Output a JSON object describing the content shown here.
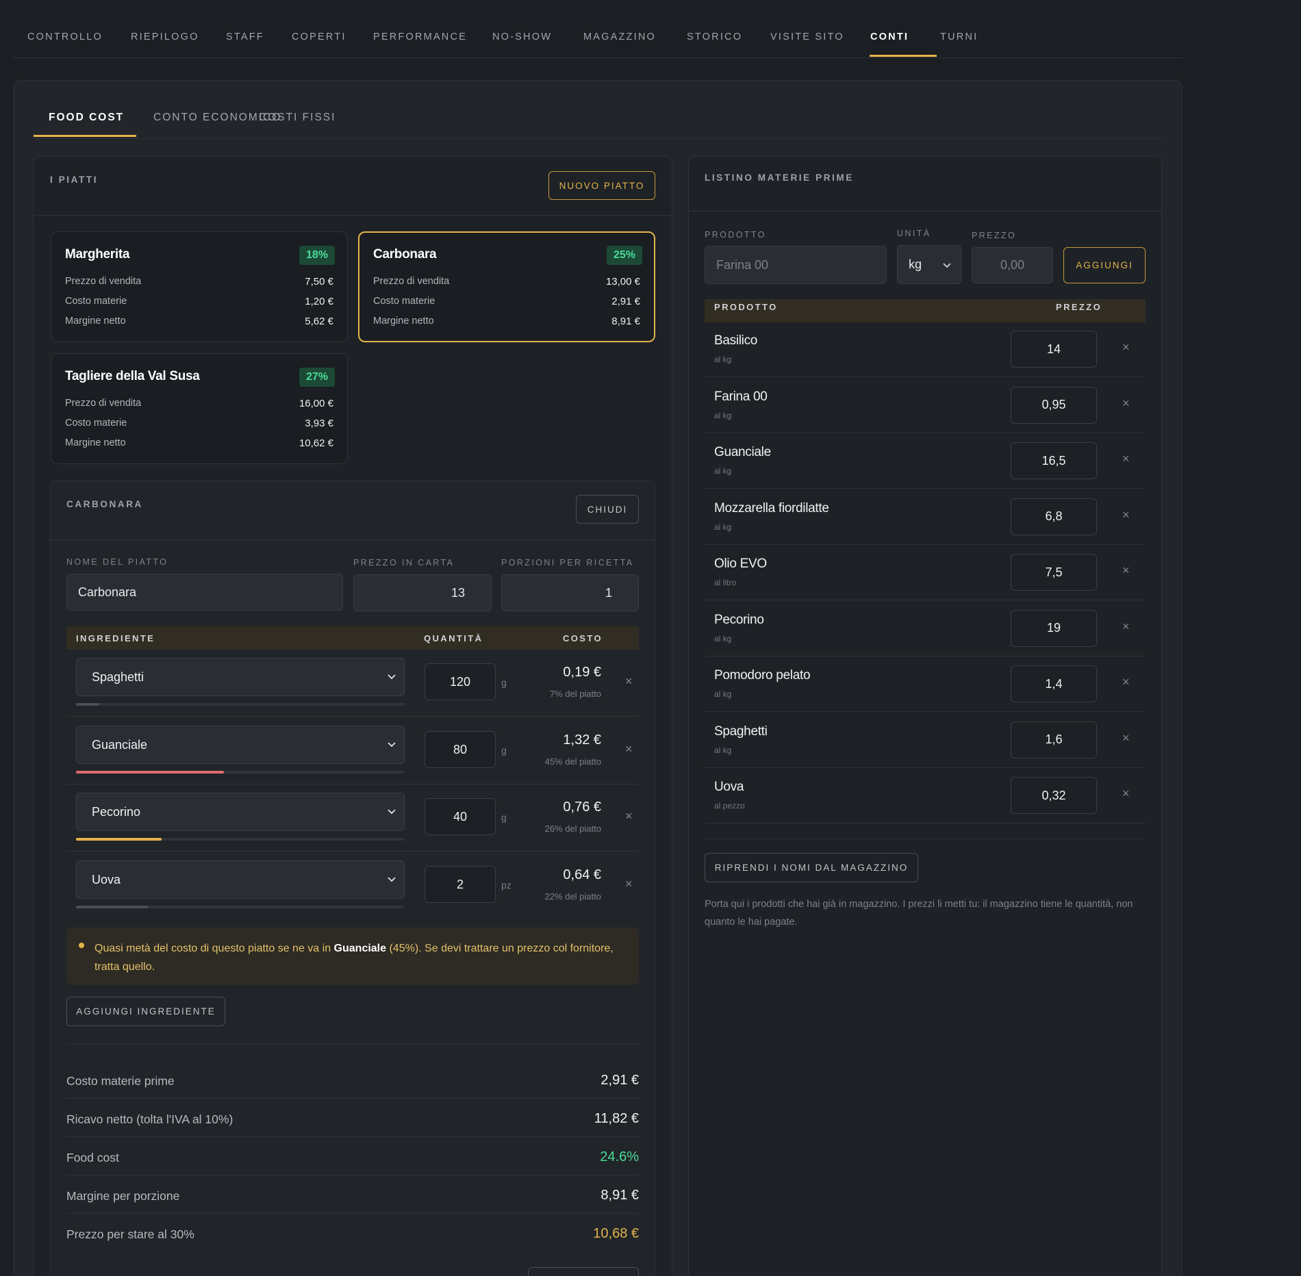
{
  "topnav": [
    "CONTROLLO",
    "RIEPILOGO",
    "STAFF",
    "COPERTI",
    "PERFORMANCE",
    "NO-SHOW",
    "MAGAZZINO",
    "STORICO",
    "VISITE SITO",
    "CONTI",
    "TURNI"
  ],
  "topnav_active": "CONTI",
  "subnav": [
    "FOOD COST",
    "CONTO ECONOMICO",
    "COSTI FISSI"
  ],
  "piatti": {
    "title": "I PIATTI",
    "new_button": "NUOVO PIATTO",
    "dishes": [
      {
        "name": "Margherita",
        "badge": "18%",
        "rows": [
          {
            "label": "Prezzo di vendita",
            "value": "7,50 €"
          },
          {
            "label": "Costo materie",
            "value": "1,20 €"
          },
          {
            "label": "Margine netto",
            "value": "5,62 €"
          }
        ]
      },
      {
        "name": "Carbonara",
        "badge": "25%",
        "rows": [
          {
            "label": "Prezzo di vendita",
            "value": "13,00 €"
          },
          {
            "label": "Costo materie",
            "value": "2,91 €"
          },
          {
            "label": "Margine netto",
            "value": "8,91 €"
          }
        ]
      },
      {
        "name": "Tagliere della Val Susa",
        "badge": "27%",
        "rows": [
          {
            "label": "Prezzo di vendita",
            "value": "16,00 €"
          },
          {
            "label": "Costo materie",
            "value": "3,93 €"
          },
          {
            "label": "Margine netto",
            "value": "10,62 €"
          }
        ]
      }
    ]
  },
  "editor": {
    "title": "CARBONARA",
    "close_button": "CHIUDI",
    "name_label": "NOME DEL PIATTO",
    "name_value": "Carbonara",
    "price_label": "PREZZO IN CARTA",
    "price_value": "13",
    "portions_label": "PORZIONI PER RICETTA",
    "portions_value": "1",
    "table_headers": {
      "ingredient": "INGREDIENTE",
      "quantity": "QUANTITÀ",
      "cost": "COSTO"
    },
    "ingredients": [
      {
        "name": "Spaghetti",
        "qty": "120",
        "unit": "g",
        "cost": "0,19 €",
        "pct": "7% del piatto",
        "share": 0.07,
        "color": "#4a4e55"
      },
      {
        "name": "Guanciale",
        "qty": "80",
        "unit": "g",
        "cost": "1,32 €",
        "pct": "45% del piatto",
        "share": 0.45,
        "color": "#e06b6b"
      },
      {
        "name": "Pecorino",
        "qty": "40",
        "unit": "g",
        "cost": "0,76 €",
        "pct": "26% del piatto",
        "share": 0.26,
        "color": "#e4b44a"
      },
      {
        "name": "Uova",
        "qty": "2",
        "unit": "pz",
        "cost": "0,64 €",
        "pct": "22% del piatto",
        "share": 0.22,
        "color": "#4a4e55"
      }
    ],
    "notice": {
      "pre": "Quasi metà del costo di questo piatto se ne va in ",
      "bold": "Guanciale",
      "post": " (45%). Se devi trattare un prezzo col fornitore, tratta quello."
    },
    "add_ingredient": "AGGIUNGI INGREDIENTE",
    "summary": [
      {
        "label": "Costo materie prime",
        "value": "2,91 €",
        "tone": ""
      },
      {
        "label": "Ricavo netto (tolta l'IVA al 10%)",
        "value": "11,82 €",
        "tone": ""
      },
      {
        "label": "Food cost",
        "value": "24.6%",
        "tone": "green"
      },
      {
        "label": "Margine per porzione",
        "value": "8,91 €",
        "tone": ""
      },
      {
        "label": "Prezzo per stare al 30%",
        "value": "10,68 €",
        "tone": "gold"
      }
    ]
  },
  "listino": {
    "title": "LISTINO MATERIE PRIME",
    "product_label": "PRODOTTO",
    "product_placeholder": "Farina 00",
    "unit_label": "UNITÀ",
    "unit_value": "kg",
    "price_label": "PREZZO",
    "price_placeholder": "0,00",
    "add_button": "AGGIUNGI",
    "headers": {
      "product": "PRODOTTO",
      "price": "PREZZO"
    },
    "items": [
      {
        "name": "Basilico",
        "unit": "al kg",
        "price": "14"
      },
      {
        "name": "Farina 00",
        "unit": "al kg",
        "price": "0,95"
      },
      {
        "name": "Guanciale",
        "unit": "al kg",
        "price": "16,5"
      },
      {
        "name": "Mozzarella fiordilatte",
        "unit": "al kg",
        "price": "6,8"
      },
      {
        "name": "Olio EVO",
        "unit": "al litro",
        "price": "7,5"
      },
      {
        "name": "Pecorino",
        "unit": "al kg",
        "price": "19"
      },
      {
        "name": "Pomodoro pelato",
        "unit": "al kg",
        "price": "1,4"
      },
      {
        "name": "Spaghetti",
        "unit": "al kg",
        "price": "1,6"
      },
      {
        "name": "Uova",
        "unit": "al pezzo",
        "price": "0,32"
      }
    ],
    "import_button": "RIPRENDI I NOMI DAL MAGAZZINO",
    "help_text": "Porta qui i prodotti che hai già in magazzino. I prezzi li metti tu: il magazzino tiene le quantità, non quanto le hai pagate."
  },
  "colors": {
    "accent": "#e4b44a",
    "good": "#4ddb98",
    "danger": "#e06b6b"
  }
}
